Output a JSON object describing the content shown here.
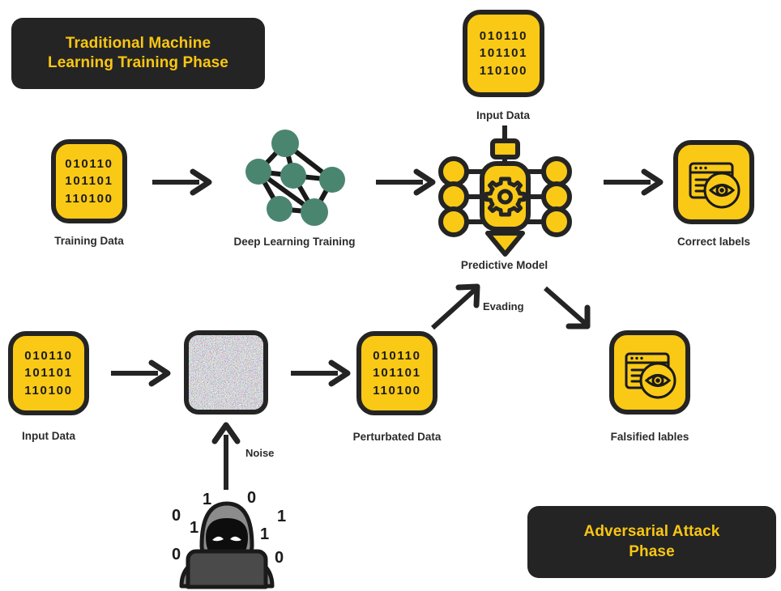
{
  "diagram": {
    "title": "Traditional Machine Learning Training Phase and Adversarial Attack Phase",
    "colors": {
      "yellow": "#f9c916",
      "dark": "#242424",
      "green_node": "#4a8570",
      "text": "#2b2b2b"
    }
  },
  "banners": {
    "training_phase": "Traditional Machine\nLearning Training Phase",
    "training_phase_line1": "Traditional Machine",
    "training_phase_line2": "Learning Training Phase",
    "attack_phase_line1": "Adversarial Attack",
    "attack_phase_line2": "Phase"
  },
  "binary": {
    "row1": "010110",
    "row2": "101101",
    "row3": "110100"
  },
  "nodes": {
    "training_data": {
      "label": "Training Data",
      "icon": "binary-data-card-icon"
    },
    "deep_learning": {
      "label": "Deep Learning Training",
      "icon": "neural-network-icon"
    },
    "predictive_model": {
      "label": "Predictive Model",
      "icon": "chip-gear-icon"
    },
    "correct_labels": {
      "label": "Correct labels",
      "icon": "browser-eye-icon"
    },
    "top_input_data": {
      "label": "Input Data",
      "icon": "binary-data-card-icon"
    },
    "input_data": {
      "label": "Input Data",
      "icon": "binary-data-card-icon"
    },
    "noise_block": {
      "label": "",
      "icon": "static-noise-icon"
    },
    "perturbated_data": {
      "label": "Perturbated Data",
      "icon": "binary-data-card-icon"
    },
    "falsified_labels": {
      "label": "Falsified lables",
      "icon": "browser-eye-icon"
    },
    "attacker": {
      "label": "",
      "icon": "hooded-hacker-icon"
    }
  },
  "edges": {
    "noise": "Noise",
    "evading": "Evading"
  },
  "attacker_digits": {
    "d1": "1",
    "d2": "0",
    "d3": "0",
    "d4": "1",
    "d5": "0",
    "d6": "1",
    "d7": "1",
    "d8": "0"
  }
}
